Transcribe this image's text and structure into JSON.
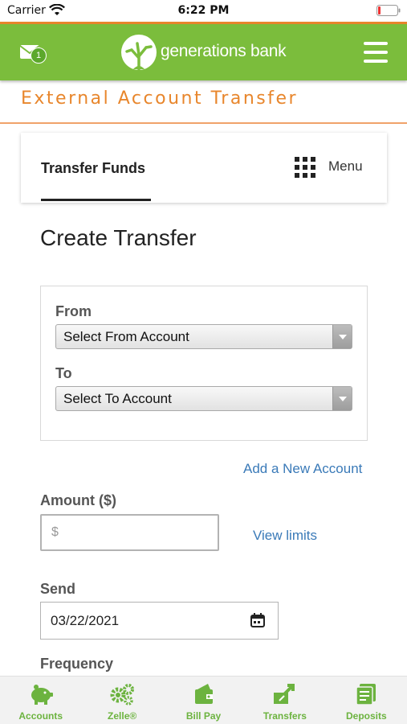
{
  "status_bar": {
    "carrier": "Carrier",
    "time": "6:22 PM"
  },
  "header": {
    "brand_name": "generations bank",
    "mail_badge": "1"
  },
  "page": {
    "title": "External Account Transfer"
  },
  "tabs": {
    "active": "Transfer Funds",
    "menu": "Menu"
  },
  "form": {
    "heading": "Create Transfer",
    "from_label": "From",
    "from_select": "Select From Account",
    "to_label": "To",
    "to_select": "Select To Account",
    "add_account_link": "Add a New Account",
    "amount_label": "Amount ($)",
    "amount_prefix": "$",
    "view_limits_link": "View limits",
    "send_label": "Send",
    "send_date": "03/22/2021",
    "frequency_label": "Frequency"
  },
  "bottom_nav": [
    {
      "label": "Accounts",
      "icon": "piggy-bank-icon"
    },
    {
      "label": "Zelle®",
      "icon": "gears-icon"
    },
    {
      "label": "Bill Pay",
      "icon": "wallet-icon"
    },
    {
      "label": "Transfers",
      "icon": "transfer-arrows-icon"
    },
    {
      "label": "Deposits",
      "icon": "check-deposit-icon"
    }
  ],
  "colors": {
    "brand_green": "#7bbd3c",
    "accent_orange": "#e8862c",
    "link_blue": "#3a7ab8"
  }
}
